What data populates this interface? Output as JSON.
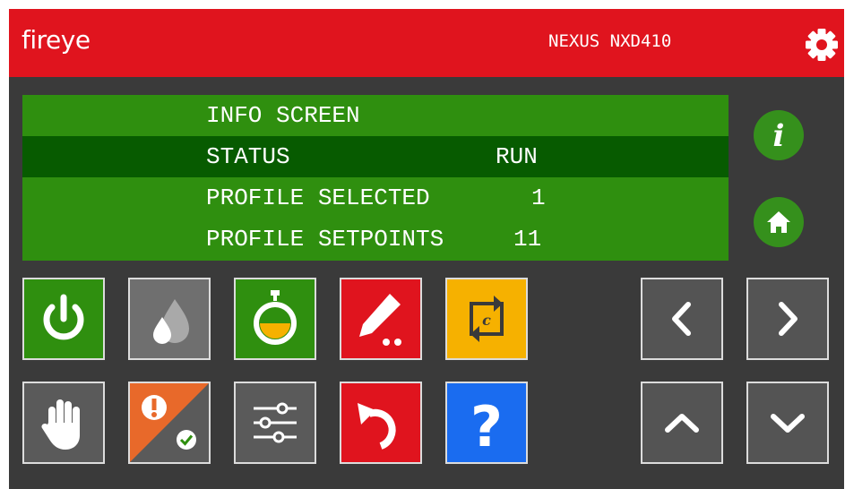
{
  "header": {
    "logo_text": "fireye",
    "device_name": "NEXUS NXD410",
    "settings_icon": "gear-icon",
    "background_color": "#e0141e"
  },
  "display": {
    "title": "INFO SCREEN",
    "rows": [
      {
        "label": "STATUS",
        "value": "RUN",
        "highlighted": true
      },
      {
        "label": "PROFILE SELECTED",
        "value": "1",
        "highlighted": false
      },
      {
        "label": "PROFILE SETPOINTS",
        "value": "11",
        "highlighted": false
      }
    ],
    "background_color": "#2f8f0f",
    "highlight_color": "#075b00"
  },
  "side_buttons": [
    {
      "name": "info-button",
      "icon": "info-icon"
    },
    {
      "name": "home-button",
      "icon": "home-icon"
    }
  ],
  "function_buttons": [
    {
      "name": "power-button",
      "icon": "power-icon",
      "color": "#2f8f0f"
    },
    {
      "name": "fuel-button",
      "icon": "flame-drop-icon",
      "color": "#6f6f6f"
    },
    {
      "name": "timer-button",
      "icon": "stopwatch-icon",
      "color": "#2f8f0f"
    },
    {
      "name": "edit-button",
      "icon": "pencil-icon",
      "color": "#e0141e"
    },
    {
      "name": "cycle-button",
      "icon": "cycle-icon",
      "color": "#f6b100"
    },
    {
      "name": "manual-button",
      "icon": "hand-icon",
      "color": "#5a5a5a"
    },
    {
      "name": "alarm-button",
      "icon": "alarm-status-icon",
      "color": "#e8692a"
    },
    {
      "name": "adjust-button",
      "icon": "sliders-icon",
      "color": "#5a5a5a"
    },
    {
      "name": "undo-button",
      "icon": "undo-icon",
      "color": "#e0141e"
    },
    {
      "name": "help-button",
      "icon": "question-icon",
      "color": "#1a6cf0"
    }
  ],
  "nav_buttons": [
    {
      "name": "left-button",
      "icon": "chevron-left-icon"
    },
    {
      "name": "right-button",
      "icon": "chevron-right-icon"
    },
    {
      "name": "up-button",
      "icon": "chevron-up-icon"
    },
    {
      "name": "down-button",
      "icon": "chevron-down-icon"
    }
  ]
}
